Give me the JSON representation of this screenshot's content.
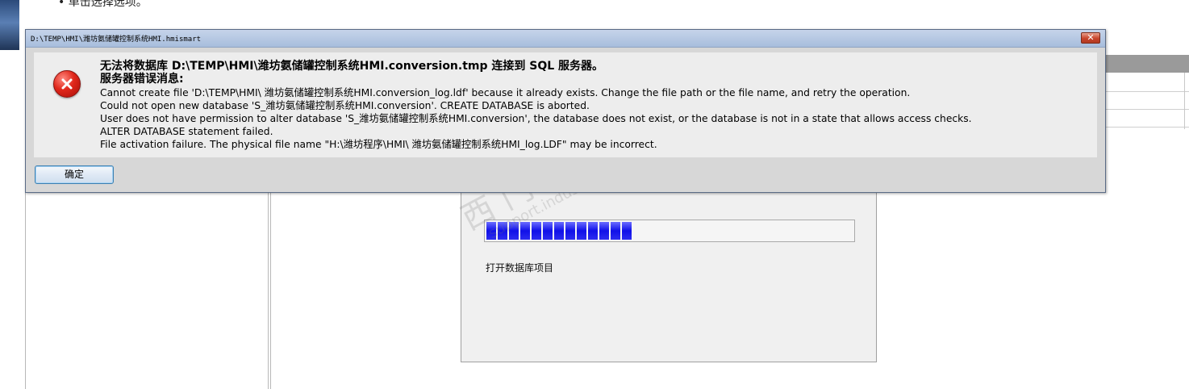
{
  "background": {
    "bullet_text": "• 单击选择选项。"
  },
  "progress": {
    "status_text": "打开数据库项目",
    "fraction": 0.42
  },
  "watermark": {
    "text_cn": "西门子工业 找答案",
    "url": "support.industry.siemens.com/cs"
  },
  "dialog": {
    "title": "D:\\TEMP\\HMI\\潍坊氨储罐控制系统HMI.hmismart",
    "close_glyph": "✕",
    "headline": "无法将数据库 D:\\TEMP\\HMI\\潍坊氨储罐控制系统HMI.conversion.tmp 连接到 SQL 服务器。",
    "subhead": "服务器错误消息:",
    "lines": [
      "Cannot create file 'D:\\TEMP\\HMI\\ 潍坊氨储罐控制系统HMI.conversion_log.ldf' because it already exists. Change the file path or the file name, and retry the operation.",
      "Could not open new database 'S_潍坊氨储罐控制系统HMI.conversion'. CREATE DATABASE is aborted.",
      "User does not have permission to alter database 'S_潍坊氨储罐控制系统HMI.conversion', the database does not exist, or the database is not in a state that allows access checks.",
      "ALTER DATABASE statement failed.",
      "File activation failure. The physical file name \"H:\\潍坊程序\\HMI\\ 潍坊氨储罐控制系统HMI_log.LDF\" may be incorrect."
    ],
    "ok_label": "确定",
    "icon": "error-x-icon"
  }
}
